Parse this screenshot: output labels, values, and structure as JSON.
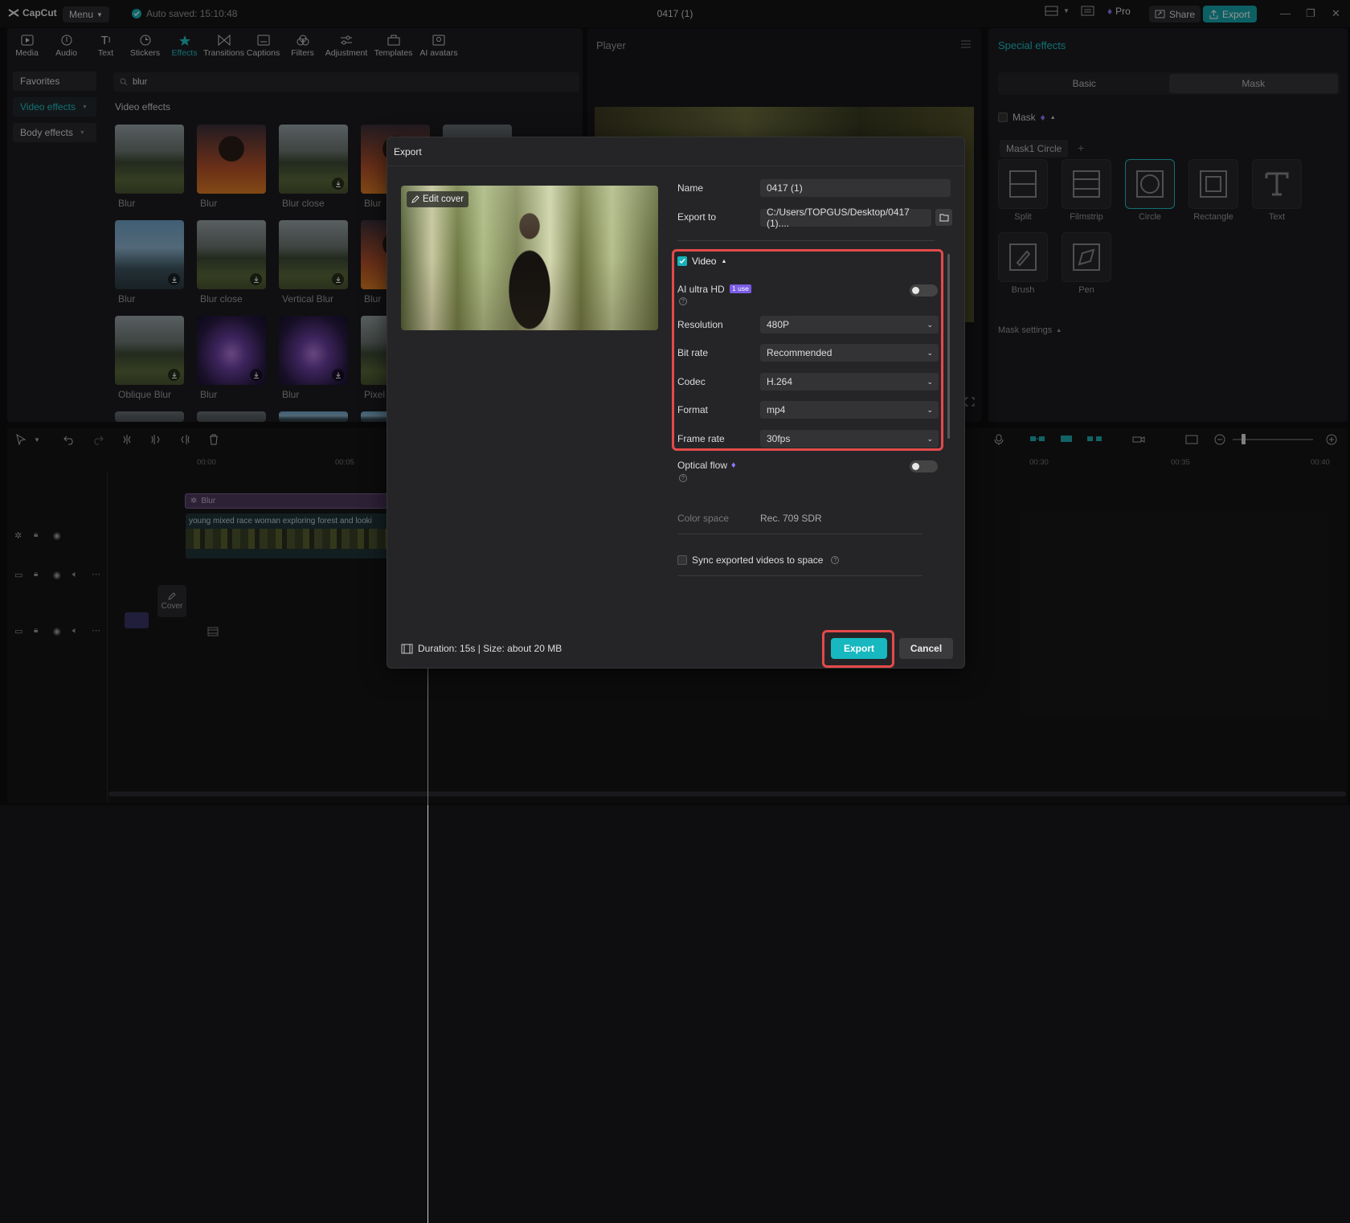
{
  "titlebar": {
    "app_name": "CapCut",
    "menu_label": "Menu",
    "autosave": "Auto saved: 15:10:48",
    "doc_title": "0417 (1)",
    "pro_label": "Pro",
    "share_label": "Share",
    "export_label": "Export"
  },
  "toolbar": {
    "tools": [
      "Media",
      "Audio",
      "Text",
      "Stickers",
      "Effects",
      "Transitions",
      "Captions",
      "Filters",
      "Adjustment",
      "Templates",
      "AI avatars"
    ],
    "active": "Effects"
  },
  "effects_panel": {
    "categories": [
      "Favorites",
      "Video effects",
      "Body effects"
    ],
    "search_value": "blur",
    "section_title": "Video effects",
    "items": [
      {
        "label": "Blur"
      },
      {
        "label": "Blur"
      },
      {
        "label": "Blur close"
      },
      {
        "label": "Blur"
      },
      {
        "label": "Blur"
      },
      {
        "label": "Blur close"
      },
      {
        "label": "Vertical Blur"
      },
      {
        "label": "Blur"
      },
      {
        "label": "Oblique Blur"
      },
      {
        "label": "Blur"
      },
      {
        "label": "Blur"
      },
      {
        "label": "Pixel"
      }
    ]
  },
  "player": {
    "title": "Player"
  },
  "right_panel": {
    "title": "Special effects",
    "tabs": [
      "Basic",
      "Mask"
    ],
    "active_tab": "Mask",
    "mask_label": "Mask",
    "mask_chip": "Mask1 Circle",
    "shapes": [
      "Split",
      "Filmstrip",
      "Circle",
      "Rectangle",
      "Text",
      "Brush",
      "Pen"
    ],
    "mask_settings": "Mask settings"
  },
  "timeline": {
    "ruler": [
      "00:00",
      "00:05",
      "00:30",
      "00:35",
      "00:40"
    ],
    "effect_clip": "Blur",
    "video_clip": "young mixed race woman exploring forest and looki",
    "cover_label": "Cover"
  },
  "dialog": {
    "title": "Export",
    "edit_cover": "Edit cover",
    "name_label": "Name",
    "name_value": "0417 (1)",
    "export_to_label": "Export to",
    "export_to_value": "C:/Users/TOPGUS/Desktop/0417 (1)....",
    "video_label": "Video",
    "ai_hd_label": "AI ultra HD",
    "ai_hd_badge": "1 use",
    "resolution_label": "Resolution",
    "resolution_value": "480P",
    "bitrate_label": "Bit rate",
    "bitrate_value": "Recommended",
    "codec_label": "Codec",
    "codec_value": "H.264",
    "format_label": "Format",
    "format_value": "mp4",
    "framerate_label": "Frame rate",
    "framerate_value": "30fps",
    "optical_flow_label": "Optical flow",
    "colorspace_label": "Color space",
    "colorspace_value": "Rec. 709 SDR",
    "sync_label": "Sync exported videos to space",
    "footer_info": "Duration: 15s | Size: about 20 MB",
    "export_button": "Export",
    "cancel_button": "Cancel"
  },
  "colors": {
    "accent": "#17b8bf",
    "highlight": "#e44a4a",
    "badge": "#7b5ce6"
  }
}
